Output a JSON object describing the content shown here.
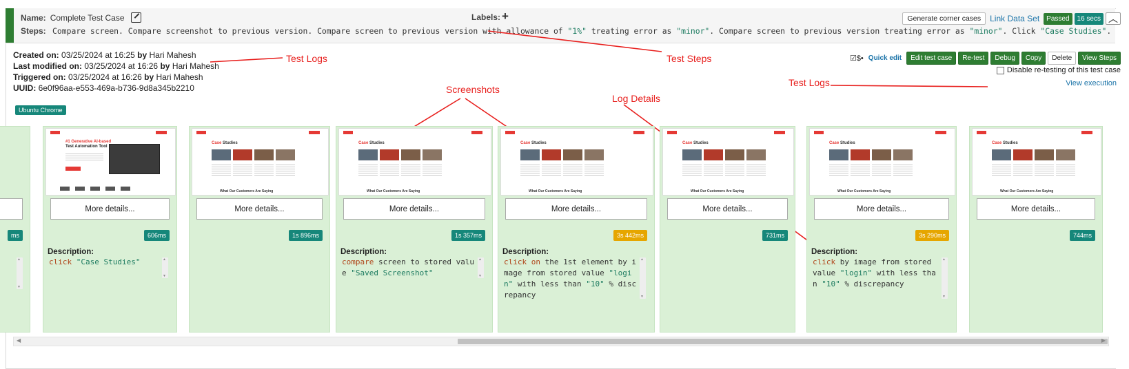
{
  "header": {
    "name_label": "Name:",
    "name_value": "Complete Test Case",
    "labels_label": "Labels:",
    "add_label_icon": "plus-icon",
    "steps_label": "Steps:",
    "steps_parts": [
      {
        "t": "Compare screen. Compare screenshot to previous version. Compare screen to previous version with allowance of ",
        "c": "plain"
      },
      {
        "t": "\"1%\"",
        "c": "str"
      },
      {
        "t": " treating error as ",
        "c": "plain"
      },
      {
        "t": "\"minor\"",
        "c": "str"
      },
      {
        "t": ". Compare screen to previous version treating error as ",
        "c": "plain"
      },
      {
        "t": "\"minor\"",
        "c": "str"
      },
      {
        "t": ". Click ",
        "c": "plain"
      },
      {
        "t": "\"Case Studies\"",
        "c": "str"
      },
      {
        "t": ". Compa...",
        "c": "plain"
      }
    ],
    "generate_corner_cases": "Generate corner cases",
    "link_data_set": "Link Data Set",
    "status": "Passed",
    "duration": "16 secs"
  },
  "meta": {
    "created_label": "Created on:",
    "created_value": "03/25/2024 at 16:25",
    "modified_label": "Last modified on:",
    "modified_value": "03/25/2024 at 16:26",
    "triggered_label": "Triggered on:",
    "triggered_value": "03/25/2024 at 16:26",
    "by": "by",
    "user": "Hari Mahesh",
    "uuid_label": "UUID:",
    "uuid_value": "6e0f96aa-e553-469a-b736-9d8a345b2210",
    "environment": "Ubuntu Chrome"
  },
  "actions": {
    "icons_text": "☑$•",
    "quick_edit": "Quick edit",
    "edit_test_case": "Edit test case",
    "retest": "Re-test",
    "debug": "Debug",
    "copy": "Copy",
    "delete": "Delete",
    "view_steps": "View Steps",
    "disable_retesting": "Disable re-testing of this test case",
    "view_execution": "View execution"
  },
  "annotations": {
    "test_logs_left": "Test Logs",
    "test_steps": "Test Steps",
    "screenshots": "Screenshots",
    "log_details": "Log Details",
    "test_logs_right": "Test Logs"
  },
  "steps": [
    {
      "time": "ms",
      "slow": false,
      "desc_label": "",
      "desc": []
    },
    {
      "time": "606ms",
      "slow": false,
      "desc_label": "Description:",
      "desc": [
        {
          "t": "click ",
          "c": "kw"
        },
        {
          "t": "\"Case Studies\"",
          "c": "str"
        }
      ],
      "thumb": "home"
    },
    {
      "time": "1s 896ms",
      "slow": false,
      "desc_label": "",
      "desc": [],
      "thumb": "cases"
    },
    {
      "time": "1s 357ms",
      "slow": false,
      "desc_label": "Description:",
      "desc": [
        {
          "t": "compare",
          "c": "kw"
        },
        {
          "t": " screen to stored value ",
          "c": "plain"
        },
        {
          "t": "\"Saved Screenshot\"",
          "c": "str"
        }
      ],
      "thumb": "cases"
    },
    {
      "time": "3s 442ms",
      "slow": true,
      "desc_label": "Description:",
      "desc": [
        {
          "t": "click on",
          "c": "kw"
        },
        {
          "t": " the 1st element by image from stored value ",
          "c": "plain"
        },
        {
          "t": "\"login\"",
          "c": "str"
        },
        {
          "t": " with less than ",
          "c": "plain"
        },
        {
          "t": "\"10\"",
          "c": "str"
        },
        {
          "t": " % discrepancy",
          "c": "plain"
        }
      ],
      "thumb": "cases"
    },
    {
      "time": "731ms",
      "slow": false,
      "desc_label": "",
      "desc": [],
      "thumb": "cases"
    },
    {
      "time": "3s 290ms",
      "slow": true,
      "desc_label": "Description:",
      "desc": [
        {
          "t": "click",
          "c": "kw"
        },
        {
          "t": " by image from stored value ",
          "c": "plain"
        },
        {
          "t": "\"login\"",
          "c": "str"
        },
        {
          "t": " with less than ",
          "c": "plain"
        },
        {
          "t": "\"10\"",
          "c": "str"
        },
        {
          "t": " % discrepancy",
          "c": "plain"
        }
      ],
      "thumb": "cases"
    },
    {
      "time": "744ms",
      "slow": false,
      "desc_label": "",
      "desc": [],
      "thumb": "cases"
    }
  ],
  "more_details": "More details...",
  "thumbnail": {
    "home_heading_accent": "#1 Generative AI-based",
    "home_heading": "Test Automation Tool",
    "cases_title_accent": "Case",
    "cases_title": " Studies",
    "footer": "What Our Customers Are Saying"
  },
  "colors": {
    "accent": "#e53935",
    "passed": "#2e7d32",
    "teal": "#16877a",
    "slow": "#e6a600",
    "card": "#daf0d6"
  }
}
